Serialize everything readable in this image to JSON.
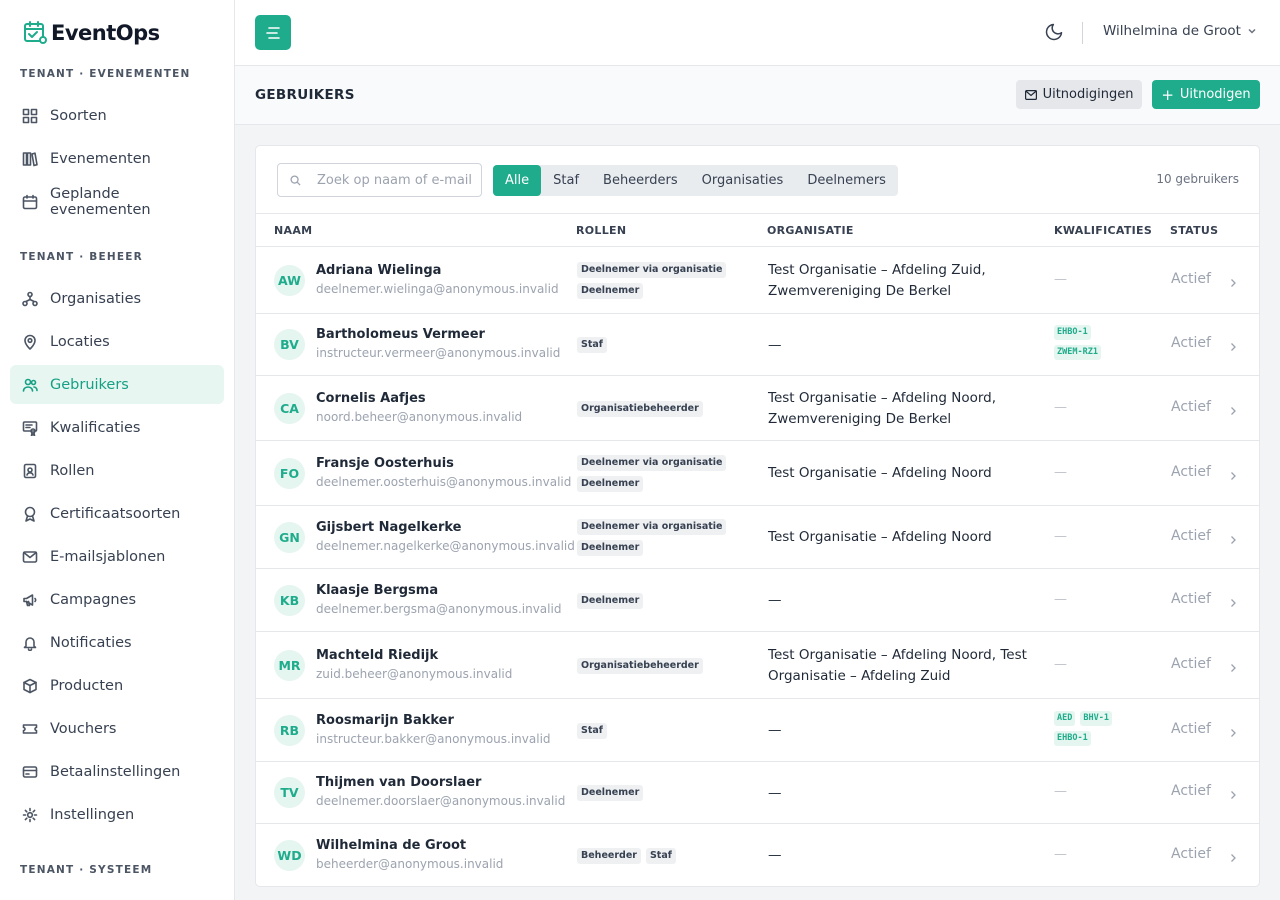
{
  "app": {
    "name": "EventOps"
  },
  "sidebar": {
    "sections": [
      {
        "title": "TENANT · EVENEMENTEN",
        "items": [
          {
            "label": "Soorten",
            "icon": "grid-icon"
          },
          {
            "label": "Evenementen",
            "icon": "books-icon"
          },
          {
            "label": "Geplande evenementen",
            "icon": "calendar-icon"
          }
        ]
      },
      {
        "title": "TENANT · BEHEER",
        "items": [
          {
            "label": "Organisaties",
            "icon": "organization-icon"
          },
          {
            "label": "Locaties",
            "icon": "map-pin-icon"
          },
          {
            "label": "Gebruikers",
            "icon": "users-icon",
            "active": true
          },
          {
            "label": "Kwalificaties",
            "icon": "certificate-icon"
          },
          {
            "label": "Rollen",
            "icon": "id-badge-icon"
          },
          {
            "label": "Certificaatsoorten",
            "icon": "award-icon"
          },
          {
            "label": "E-mailsjablonen",
            "icon": "mail-template-icon"
          },
          {
            "label": "Campagnes",
            "icon": "megaphone-icon"
          },
          {
            "label": "Notificaties",
            "icon": "bell-icon"
          },
          {
            "label": "Producten",
            "icon": "package-icon"
          },
          {
            "label": "Vouchers",
            "icon": "ticket-icon"
          },
          {
            "label": "Betaalinstellingen",
            "icon": "credit-card-icon"
          },
          {
            "label": "Instellingen",
            "icon": "gear-icon"
          }
        ]
      },
      {
        "title": "TENANT · SYSTEEM",
        "items": []
      }
    ]
  },
  "header": {
    "user_name": "Wilhelmina de Groot"
  },
  "page": {
    "title": "GEBRUIKERS",
    "invitations_label": "Uitnodigingen",
    "invite_label": "Uitnodigen"
  },
  "toolbar": {
    "search_placeholder": "Zoek op naam of e-mail",
    "filters": [
      "Alle",
      "Staf",
      "Beheerders",
      "Organisaties",
      "Deelnemers"
    ],
    "active_filter": "Alle",
    "count_label": "10 gebruikers"
  },
  "table": {
    "headers": {
      "name": "NAAM",
      "roles": "ROLLEN",
      "organization": "ORGANISATIE",
      "qualifications": "KWALIFICATIES",
      "status": "STATUS"
    },
    "empty": "—",
    "rows": [
      {
        "initials": "AW",
        "name": "Adriana Wielinga",
        "email": "deelnemer.wielinga@anonymous.invalid",
        "roles": [
          "Deelnemer via organisatie",
          "Deelnemer"
        ],
        "organization": "Test Organisatie – Afdeling Zuid, Zwemvereniging De Berkel",
        "qualifications": [],
        "status": "Actief"
      },
      {
        "initials": "BV",
        "name": "Bartholomeus Vermeer",
        "email": "instructeur.vermeer@anonymous.invalid",
        "roles": [
          "Staf"
        ],
        "organization": "—",
        "qualifications": [
          "EHBO-1",
          "ZWEM-RZ1"
        ],
        "status": "Actief"
      },
      {
        "initials": "CA",
        "name": "Cornelis Aafjes",
        "email": "noord.beheer@anonymous.invalid",
        "roles": [
          "Organisatiebeheerder"
        ],
        "organization": "Test Organisatie – Afdeling Noord, Zwemvereniging De Berkel",
        "qualifications": [],
        "status": "Actief"
      },
      {
        "initials": "FO",
        "name": "Fransje Oosterhuis",
        "email": "deelnemer.oosterhuis@anonymous.invalid",
        "roles": [
          "Deelnemer via organisatie",
          "Deelnemer"
        ],
        "organization": "Test Organisatie – Afdeling Noord",
        "qualifications": [],
        "status": "Actief"
      },
      {
        "initials": "GN",
        "name": "Gijsbert Nagelkerke",
        "email": "deelnemer.nagelkerke@anonymous.invalid",
        "roles": [
          "Deelnemer via organisatie",
          "Deelnemer"
        ],
        "organization": "Test Organisatie – Afdeling Noord",
        "qualifications": [],
        "status": "Actief"
      },
      {
        "initials": "KB",
        "name": "Klaasje Bergsma",
        "email": "deelnemer.bergsma@anonymous.invalid",
        "roles": [
          "Deelnemer"
        ],
        "organization": "—",
        "qualifications": [],
        "status": "Actief"
      },
      {
        "initials": "MR",
        "name": "Machteld Riedijk",
        "email": "zuid.beheer@anonymous.invalid",
        "roles": [
          "Organisatiebeheerder"
        ],
        "organization": "Test Organisatie – Afdeling Noord, Test Organisatie – Afdeling Zuid",
        "qualifications": [],
        "status": "Actief"
      },
      {
        "initials": "RB",
        "name": "Roosmarijn Bakker",
        "email": "instructeur.bakker@anonymous.invalid",
        "roles": [
          "Staf"
        ],
        "organization": "—",
        "qualifications": [
          "AED",
          "BHV-1",
          "EHBO-1"
        ],
        "status": "Actief"
      },
      {
        "initials": "TV",
        "name": "Thijmen van Doorslaer",
        "email": "deelnemer.doorslaer@anonymous.invalid",
        "roles": [
          "Deelnemer"
        ],
        "organization": "—",
        "qualifications": [],
        "status": "Actief"
      },
      {
        "initials": "WD",
        "name": "Wilhelmina de Groot",
        "email": "beheerder@anonymous.invalid",
        "roles": [
          "Beheerder",
          "Staf"
        ],
        "organization": "—",
        "qualifications": [],
        "status": "Actief"
      }
    ]
  },
  "colors": {
    "accent": "#1fac8c",
    "accent_light": "#e5f5ef"
  }
}
